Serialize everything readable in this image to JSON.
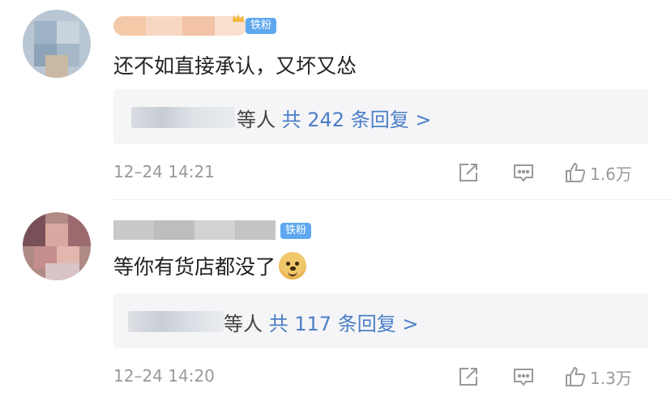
{
  "comments": [
    {
      "badge": "铁粉",
      "text": "还不如直接承认，又坏又怂",
      "reply_who": "等人",
      "reply_count": "共 242 条回复 >",
      "time": "12–24 14:21",
      "likes": "1.6万"
    },
    {
      "badge": "铁粉",
      "text": "等你有货店都没了",
      "reply_who": "等人",
      "reply_count": "共 117 条回复 >",
      "time": "12–24 14:20",
      "likes": "1.3万"
    }
  ],
  "colors": {
    "badge": "#5ea8f0",
    "link": "#4a7ec8",
    "meta": "#999999"
  },
  "icons": [
    "share-icon",
    "comment-icon",
    "thumbs-up-icon",
    "crown-icon",
    "doge-emoji-icon"
  ]
}
